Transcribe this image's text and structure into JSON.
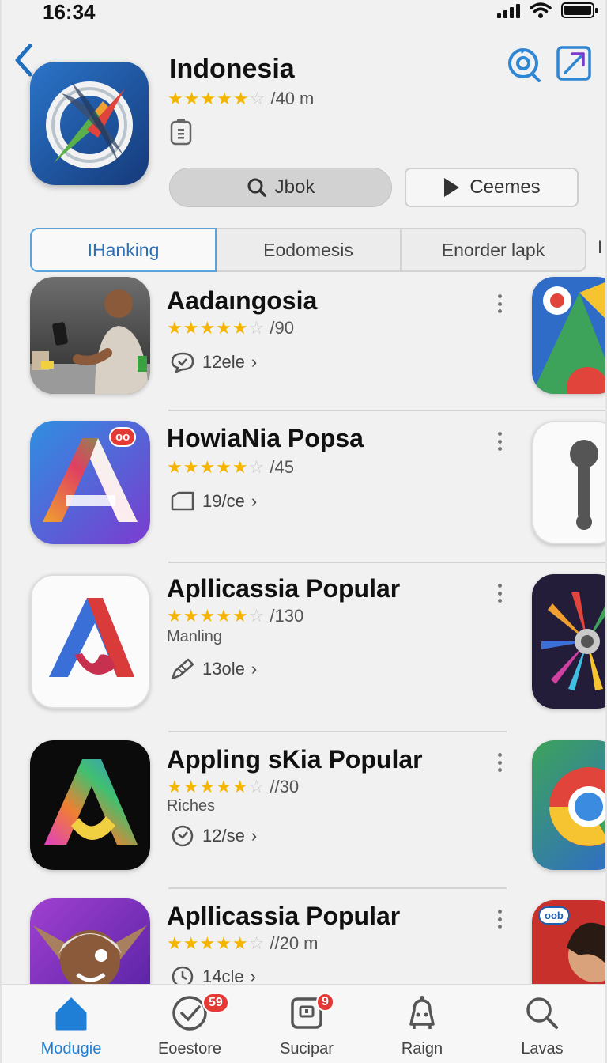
{
  "status_bar": {
    "time": "16:34"
  },
  "header": {
    "title": "Indonesia",
    "rating_text": "/40 m",
    "primary_button": "Jbok",
    "secondary_button": "Ceemes"
  },
  "tabs": [
    {
      "label": "IHanking",
      "active": true
    },
    {
      "label": "Eodomesis",
      "active": false
    },
    {
      "label": "Enorder lapk",
      "active": false
    }
  ],
  "tab_overflow": "I",
  "apps": [
    {
      "name": "Aadaıngosia",
      "rating_text": "/90",
      "subtitle": "",
      "meta": "12ele",
      "stars": 4.5
    },
    {
      "name": "HowiaNia Popsa",
      "rating_text": "/45",
      "subtitle": "",
      "meta": "19/ce",
      "stars": 4.5,
      "badge": "oo"
    },
    {
      "name": "Apllicassia Popular",
      "rating_text": "/130",
      "subtitle": "Manling",
      "meta": "13ole",
      "stars": 4.5
    },
    {
      "name": "Appling  sKia Popular",
      "rating_text": "//30",
      "subtitle": "Riches",
      "meta": "12/se",
      "stars": 4.5
    },
    {
      "name": "Apllicassia Popular",
      "rating_text": "//20 m",
      "subtitle": "",
      "meta": "14cle",
      "stars": 4.5
    }
  ],
  "side_badge": "oob",
  "bottom_nav": [
    {
      "label": "Modugie",
      "active": true,
      "badge": ""
    },
    {
      "label": "Eoestore",
      "active": false,
      "badge": "59"
    },
    {
      "label": "Sucipar",
      "active": false,
      "badge": "9"
    },
    {
      "label": "Raign",
      "active": false,
      "badge": ""
    },
    {
      "label": "Lavas",
      "active": false,
      "badge": ""
    }
  ],
  "colors": {
    "accent": "#1f7fd6",
    "star": "#f4b400",
    "badge": "#e53935"
  }
}
